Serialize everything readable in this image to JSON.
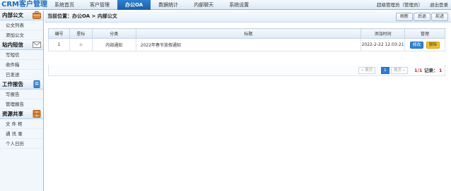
{
  "app": {
    "title": "CRM客户管理"
  },
  "nav": {
    "items": [
      "系统首页",
      "客户管理",
      "办公OA",
      "数据统计",
      "内部聊天",
      "系统设置"
    ],
    "active_index": 2
  },
  "user": {
    "info": "超级管理员（管理员）",
    "logout": "退出登录"
  },
  "sidebar": {
    "sections": [
      {
        "title": "内部公文",
        "icon": "briefcase-icon",
        "items": [
          "公文列表",
          "添加公文"
        ]
      },
      {
        "title": "站内短信",
        "icon": "envelope-icon",
        "items": [
          "写短信",
          "收件箱",
          "已发送"
        ]
      },
      {
        "title": "工作报告",
        "icon": "report-icon",
        "items": [
          "写报告",
          "管理报告"
        ]
      },
      {
        "title": "资源共享",
        "icon": "cabinet-icon",
        "items": [
          "文 件 柜",
          "通 讯 录",
          "个人日历"
        ]
      }
    ]
  },
  "breadcrumb": "当前位置：办公OA > 内部公文",
  "toolbar": {
    "refresh": "刷新",
    "back": "后退",
    "forward": "前进"
  },
  "table": {
    "headers": [
      "编号",
      "星标",
      "分类",
      "标题",
      "添加时间",
      "管理"
    ],
    "rows": [
      {
        "id": "1",
        "category": "内部通知",
        "title": "2022年春节放假通知",
        "time": "2022-2-22 12:03:21",
        "edit": "修改",
        "delete": "删除"
      }
    ]
  },
  "pager": {
    "first": "首页",
    "current": "1",
    "last": "尾页",
    "page_info": "1/1",
    "records_label": "记录：",
    "records": "1"
  },
  "colors": {
    "accent": "#1c6bb8",
    "pager_info": "#d22222"
  }
}
